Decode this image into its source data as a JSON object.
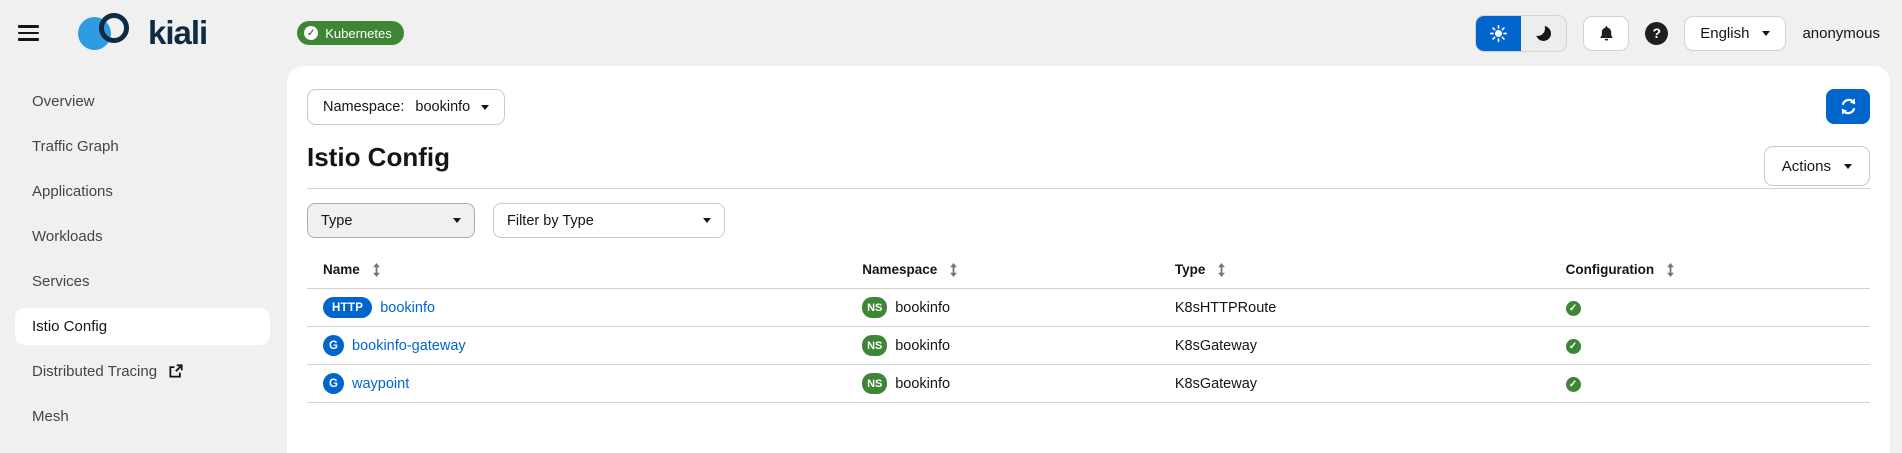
{
  "colors": {
    "accent_blue": "#0066cc",
    "success_green": "#3e8635",
    "surface_gray": "#f0f0f0",
    "link_blue": "#0066cc",
    "text_dark": "#151515"
  },
  "icons": {
    "check": "✓",
    "help": "?"
  },
  "masthead": {
    "brand": "kiali",
    "kubernetes_label": "Kubernetes",
    "language": "English",
    "user": "anonymous"
  },
  "sidebar": {
    "items": [
      {
        "label": "Overview"
      },
      {
        "label": "Traffic Graph"
      },
      {
        "label": "Applications"
      },
      {
        "label": "Workloads"
      },
      {
        "label": "Services"
      },
      {
        "label": "Istio Config",
        "active": true
      },
      {
        "label": "Distributed Tracing",
        "external": true
      },
      {
        "label": "Mesh"
      }
    ]
  },
  "content": {
    "namespace_label": "Namespace:",
    "namespace_value": "bookinfo",
    "title": "Istio Config",
    "actions_label": "Actions",
    "toolbar": {
      "type_label": "Type",
      "filter_label": "Filter by Type"
    },
    "table": {
      "columns": [
        {
          "label": "Name"
        },
        {
          "label": "Namespace"
        },
        {
          "label": "Type"
        },
        {
          "label": "Configuration"
        }
      ],
      "rows": [
        {
          "badge": "HTTP",
          "name": "bookinfo",
          "namespace_badge": "NS",
          "namespace": "bookinfo",
          "type": "K8sHTTPRoute",
          "configuration": "valid"
        },
        {
          "badge": "G",
          "name": "bookinfo-gateway",
          "namespace_badge": "NS",
          "namespace": "bookinfo",
          "type": "K8sGateway",
          "configuration": "valid"
        },
        {
          "badge": "G",
          "name": "waypoint",
          "namespace_badge": "NS",
          "namespace": "bookinfo",
          "type": "K8sGateway",
          "configuration": "valid"
        }
      ]
    }
  }
}
